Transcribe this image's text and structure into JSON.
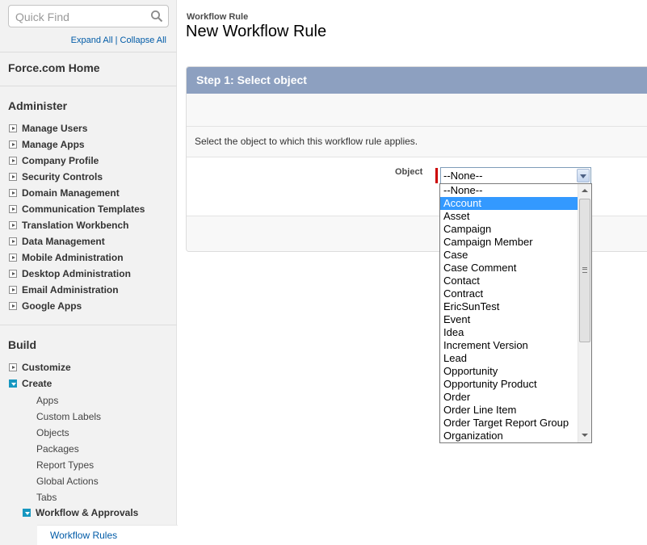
{
  "sidebar": {
    "search": {
      "placeholder": "Quick Find"
    },
    "expand_all": "Expand All",
    "separator": "|",
    "collapse_all": "Collapse All",
    "home": "Force.com Home",
    "administer": {
      "heading": "Administer",
      "items": [
        "Manage Users",
        "Manage Apps",
        "Company Profile",
        "Security Controls",
        "Domain Management",
        "Communication Templates",
        "Translation Workbench",
        "Data Management",
        "Mobile Administration",
        "Desktop Administration",
        "Email Administration",
        "Google Apps"
      ]
    },
    "build": {
      "heading": "Build",
      "customize": "Customize",
      "create": "Create",
      "create_children": [
        "Apps",
        "Custom Labels",
        "Objects",
        "Packages",
        "Report Types",
        "Global Actions",
        "Tabs"
      ],
      "workflow": "Workflow & Approvals",
      "workflow_rules": "Workflow Rules"
    }
  },
  "main": {
    "breadcrumb": "Workflow Rule",
    "title": "New Workflow Rule",
    "step_header": "Step 1: Select object",
    "description": "Select the object to which this workflow rule applies.",
    "object_label": "Object",
    "selected_value": "--None--",
    "options": [
      "--None--",
      "Account",
      "Asset",
      "Campaign",
      "Campaign Member",
      "Case",
      "Case Comment",
      "Contact",
      "Contract",
      "EricSunTest",
      "Event",
      "Idea",
      "Increment Version",
      "Lead",
      "Opportunity",
      "Opportunity Product",
      "Order",
      "Order Line Item",
      "Order Target Report Group",
      "Organization"
    ],
    "highlighted_option": "Account"
  },
  "colors": {
    "link": "#015ba7",
    "step_header_bg": "#8da0c0",
    "required_marker": "#cc0000",
    "option_highlight": "#3399ff",
    "tree_toggle_open": "#1797c0"
  },
  "icons": {
    "search": "search-icon",
    "collapsed": "expand-triangle-icon",
    "expanded": "collapse-triangle-icon",
    "dropdown": "chevron-down-icon"
  }
}
